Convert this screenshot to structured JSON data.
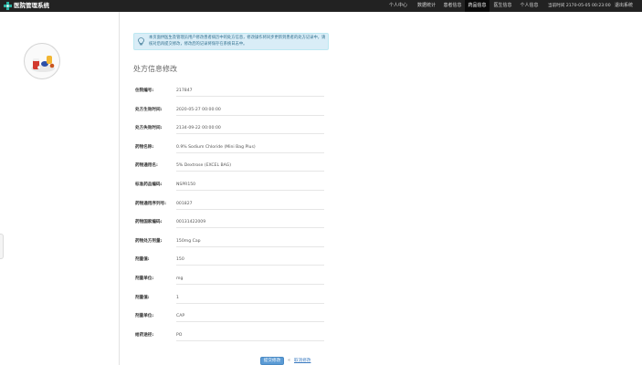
{
  "navbar": {
    "brand": "医院管理系统",
    "items": [
      {
        "label": "个人中心",
        "active": false
      },
      {
        "label": "数据统计",
        "active": false
      },
      {
        "label": "患者信息",
        "active": false
      },
      {
        "label": "药品信息",
        "active": true
      },
      {
        "label": "医生信息",
        "active": false
      },
      {
        "label": "个人信息",
        "active": false
      }
    ],
    "time": "当前时间 2170-05-05 00:23:00",
    "logout": "退出系统"
  },
  "alert": {
    "text": "本页面供医生及管理员用户修改患者病历中的处方信息，修改操作将同步更新到患者的处方记录中，请核对后再提交修改，修改后的记录将保存在系统日志中。"
  },
  "form": {
    "title": "处方信息修改",
    "fields": [
      {
        "label": "住院编号:",
        "value": "217847"
      },
      {
        "label": "处方生效时间:",
        "value": "2020-05-27 00:00:00"
      },
      {
        "label": "处方失效时间:",
        "value": "2134-09-22 00:00:00"
      },
      {
        "label": "药物名称:",
        "value": "0.9% Sodium Chloride (Mini Bag Plus)"
      },
      {
        "label": "药物通用名:",
        "value": "5% Dextrose (EXCEL BAG)"
      },
      {
        "label": "标准药品编码:",
        "value": "NSPR150"
      },
      {
        "label": "药物通用序列号:",
        "value": "001827"
      },
      {
        "label": "药物国家编码:",
        "value": "00131422009"
      },
      {
        "label": "药物处方剂量:",
        "value": "150mg Cap"
      },
      {
        "label": "剂量值:",
        "value": "150"
      },
      {
        "label": "剂量单位:",
        "value": "mg"
      },
      {
        "label": "剂量值:",
        "value": "1"
      },
      {
        "label": "剂量单位:",
        "value": "CAP"
      },
      {
        "label": "给药途径:",
        "value": "PO"
      }
    ],
    "submit": "提交修改",
    "back": "取消修改"
  },
  "colors": {
    "navbar_bg": "#222222",
    "navbar_active_bg": "#0a0a0a",
    "alert_bg": "#d9edf7",
    "alert_text": "#31708f",
    "primary_button": "#5b9bd5",
    "link": "#3a7ac0",
    "brand_icon": "#2bb3a3"
  },
  "icons": {
    "brand": "hospital-cross-icon",
    "alert": "lightbulb-icon",
    "back": "back-arrow-icon"
  }
}
